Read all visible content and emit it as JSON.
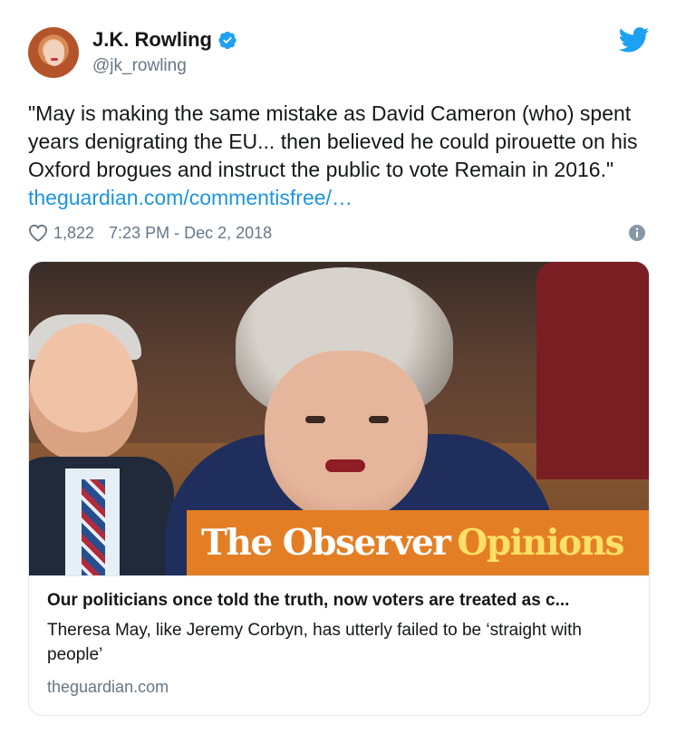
{
  "author": {
    "display_name": "J.K. Rowling",
    "handle": "@jk_rowling",
    "verified": true,
    "verified_icon": "verified-badge-icon"
  },
  "tweet": {
    "text": "\"May is making the same mistake as David Cameron (who) spent years denigrating the EU... then believed he could pirouette on his Oxford brogues and instruct the public to vote Remain in 2016.\" ",
    "link_text": "theguardian.com/commentisfree/…"
  },
  "meta": {
    "likes": "1,822",
    "timestamp": "7:23 PM - Dec 2, 2018"
  },
  "card": {
    "banner_brand": "The Observer",
    "banner_section": "Opinions",
    "title": "Our politicians once told the truth, now voters are treated as c...",
    "description": "Theresa May, like Jeremy Corbyn, has utterly failed to be ‘straight with people’",
    "domain": "theguardian.com"
  },
  "colors": {
    "link": "#1b95e0",
    "muted": "#657786",
    "banner": "#e47e24",
    "banner_accent": "#ffe066"
  }
}
